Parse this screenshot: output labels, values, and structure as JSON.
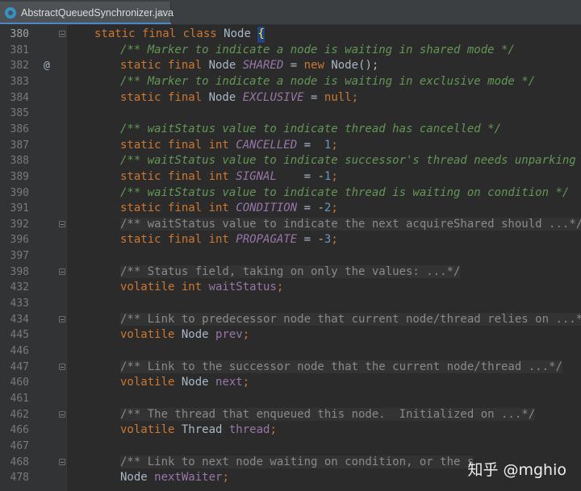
{
  "tab": {
    "filename": "AbstractQueuedSynchronizer.java",
    "close": "×"
  },
  "lines": [
    {
      "n": "380",
      "tokens": [
        {
          "t": "static final class ",
          "c": "kw"
        },
        {
          "t": "Node ",
          "c": "cls"
        },
        {
          "t": "{",
          "c": "cursor"
        }
      ]
    },
    {
      "n": "381",
      "tokens": [
        {
          "t": "/** Marker to indicate a node is waiting in shared mode */",
          "c": "doc"
        }
      ]
    },
    {
      "n": "382",
      "mark": "@",
      "tokens": [
        {
          "t": "static final ",
          "c": "kw"
        },
        {
          "t": "Node ",
          "c": "cls"
        },
        {
          "t": "SHARED",
          "c": "field"
        },
        {
          "t": " = ",
          "c": "cls"
        },
        {
          "t": "new ",
          "c": "kw"
        },
        {
          "t": "Node();",
          "c": "cls"
        }
      ]
    },
    {
      "n": "383",
      "tokens": [
        {
          "t": "/** Marker to indicate a node is waiting in exclusive mode */",
          "c": "doc"
        }
      ]
    },
    {
      "n": "384",
      "tokens": [
        {
          "t": "static final ",
          "c": "kw"
        },
        {
          "t": "Node ",
          "c": "cls"
        },
        {
          "t": "EXCLUSIVE",
          "c": "field"
        },
        {
          "t": " = ",
          "c": "cls"
        },
        {
          "t": "null",
          "c": "kw"
        },
        {
          "t": ";",
          "c": "kw"
        }
      ]
    },
    {
      "n": "385",
      "tokens": []
    },
    {
      "n": "386",
      "tokens": [
        {
          "t": "/** waitStatus value to indicate thread has cancelled */",
          "c": "doc"
        }
      ]
    },
    {
      "n": "387",
      "tokens": [
        {
          "t": "static final int ",
          "c": "kw"
        },
        {
          "t": "CANCELLED",
          "c": "field"
        },
        {
          "t": " =  ",
          "c": "cls"
        },
        {
          "t": "1",
          "c": "num"
        },
        {
          "t": ";",
          "c": "kw"
        }
      ]
    },
    {
      "n": "388",
      "tokens": [
        {
          "t": "/** waitStatus value to indicate successor's thread needs unparking */",
          "c": "doc"
        }
      ]
    },
    {
      "n": "389",
      "tokens": [
        {
          "t": "static final int ",
          "c": "kw"
        },
        {
          "t": "SIGNAL",
          "c": "field"
        },
        {
          "t": "    = -",
          "c": "cls"
        },
        {
          "t": "1",
          "c": "num"
        },
        {
          "t": ";",
          "c": "kw"
        }
      ]
    },
    {
      "n": "390",
      "tokens": [
        {
          "t": "/** waitStatus value to indicate thread is waiting on condition */",
          "c": "doc"
        }
      ]
    },
    {
      "n": "391",
      "tokens": [
        {
          "t": "static final int ",
          "c": "kw"
        },
        {
          "t": "CONDITION",
          "c": "field"
        },
        {
          "t": " = -",
          "c": "cls"
        },
        {
          "t": "2",
          "c": "num"
        },
        {
          "t": ";",
          "c": "kw"
        }
      ]
    },
    {
      "n": "392",
      "tokens": [
        {
          "t": "/** waitStatus value to indicate the next acquireShared should ...*/",
          "c": "fold-doc"
        }
      ]
    },
    {
      "n": "396",
      "tokens": [
        {
          "t": "static final int ",
          "c": "kw"
        },
        {
          "t": "PROPAGATE",
          "c": "field"
        },
        {
          "t": " = -",
          "c": "cls"
        },
        {
          "t": "3",
          "c": "num"
        },
        {
          "t": ";",
          "c": "kw"
        }
      ]
    },
    {
      "n": "397",
      "tokens": []
    },
    {
      "n": "398",
      "tokens": [
        {
          "t": "/** Status field, taking on only the values: ...*/",
          "c": "fold-doc"
        }
      ]
    },
    {
      "n": "432",
      "tokens": [
        {
          "t": "volatile int ",
          "c": "kw"
        },
        {
          "t": "waitStatus",
          "c": "ifield"
        },
        {
          "t": ";",
          "c": "kw"
        }
      ]
    },
    {
      "n": "433",
      "tokens": []
    },
    {
      "n": "434",
      "tokens": [
        {
          "t": "/** Link to predecessor node that current node/thread relies on ...*/",
          "c": "fold-doc"
        }
      ]
    },
    {
      "n": "445",
      "tokens": [
        {
          "t": "volatile ",
          "c": "kw"
        },
        {
          "t": "Node ",
          "c": "cls"
        },
        {
          "t": "prev",
          "c": "ifield"
        },
        {
          "t": ";",
          "c": "kw"
        }
      ]
    },
    {
      "n": "446",
      "tokens": []
    },
    {
      "n": "447",
      "tokens": [
        {
          "t": "/** Link to the successor node that the current node/thread ...*/",
          "c": "fold-doc"
        }
      ]
    },
    {
      "n": "460",
      "tokens": [
        {
          "t": "volatile ",
          "c": "kw"
        },
        {
          "t": "Node ",
          "c": "cls"
        },
        {
          "t": "next",
          "c": "ifield"
        },
        {
          "t": ";",
          "c": "kw"
        }
      ]
    },
    {
      "n": "461",
      "tokens": []
    },
    {
      "n": "462",
      "tokens": [
        {
          "t": "/** The thread that enqueued this node.  Initialized on ...*/",
          "c": "fold-doc"
        }
      ]
    },
    {
      "n": "466",
      "tokens": [
        {
          "t": "volatile ",
          "c": "kw"
        },
        {
          "t": "Thread ",
          "c": "cls"
        },
        {
          "t": "thread",
          "c": "ifield"
        },
        {
          "t": ";",
          "c": "kw"
        }
      ]
    },
    {
      "n": "467",
      "tokens": []
    },
    {
      "n": "468",
      "tokens": [
        {
          "t": "/** Link to next node waiting on condition, or the s",
          "c": "fold-doc"
        }
      ]
    },
    {
      "n": "478",
      "tokens": [
        {
          "t": "Node ",
          "c": "cls"
        },
        {
          "t": "nextWaiter",
          "c": "ifield"
        },
        {
          "t": ";",
          "c": "kw"
        }
      ]
    }
  ],
  "watermark": "知乎 @mghio"
}
